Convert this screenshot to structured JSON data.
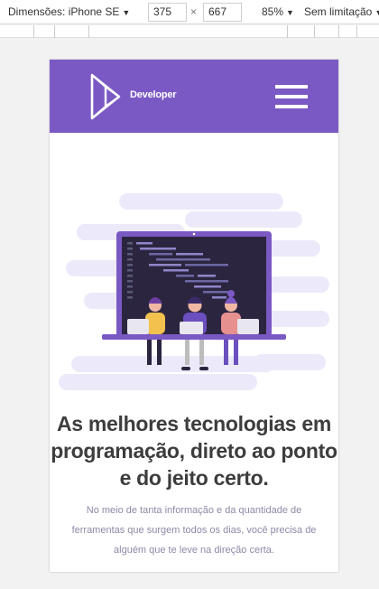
{
  "devtools": {
    "dimensions_label": "Dimensões: iPhone SE",
    "width_value": "375",
    "height_value": "667",
    "times_symbol": "×",
    "zoom_label": "85%",
    "throttle_label": "Sem limitação"
  },
  "site": {
    "brand": "Developer",
    "headline": "As melhores tecnologias em programação, direto ao ponto e do jeito certo.",
    "subtext": "No meio de tanta informação e da quantidade de ferramentas que surgem todos os dias, você precisa de alguém que te leve na direção certa."
  },
  "colors": {
    "brand_purple": "#7b59c4",
    "screen_dark": "#2c2540",
    "cloud": "#eceafa"
  },
  "icons": {
    "logo": "triangle-play-logo",
    "menu": "hamburger-menu-icon"
  }
}
